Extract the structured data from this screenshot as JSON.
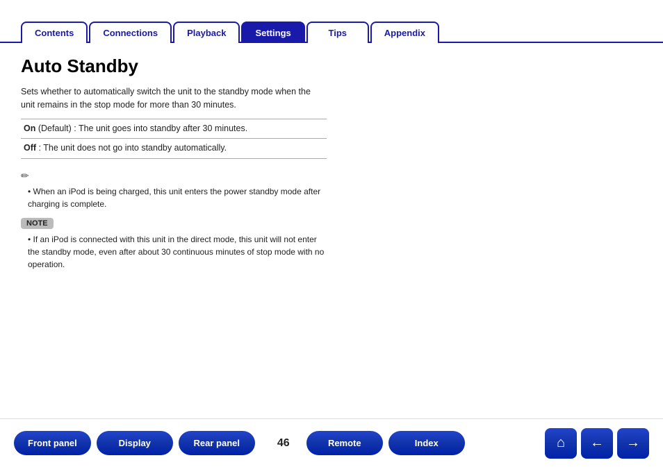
{
  "tabs": [
    {
      "id": "contents",
      "label": "Contents",
      "active": false
    },
    {
      "id": "connections",
      "label": "Connections",
      "active": false
    },
    {
      "id": "playback",
      "label": "Playback",
      "active": false
    },
    {
      "id": "settings",
      "label": "Settings",
      "active": true
    },
    {
      "id": "tips",
      "label": "Tips",
      "active": false
    },
    {
      "id": "appendix",
      "label": "Appendix",
      "active": false
    }
  ],
  "page": {
    "title": "Auto Standby",
    "description": "Sets whether to automatically switch the unit to the standby mode when the unit remains in the stop mode for more than 30 minutes.",
    "settings": [
      {
        "label": "On",
        "label_extra": " (Default) : The unit goes into standby after 30 minutes."
      },
      {
        "label": "Off",
        "label_extra": " : The unit does not go into standby automatically."
      }
    ],
    "tip_text": "When an iPod is being charged, this unit enters the power standby mode after charging is complete.",
    "note_label": "NOTE",
    "note_text": "If an iPod is connected with this unit in the direct mode, this unit will not enter the standby mode, even after about 30 continuous minutes of stop mode with no operation."
  },
  "bottom_nav": {
    "page_number": "46",
    "buttons": [
      {
        "id": "front-panel",
        "label": "Front panel"
      },
      {
        "id": "display",
        "label": "Display"
      },
      {
        "id": "rear-panel",
        "label": "Rear panel"
      },
      {
        "id": "remote",
        "label": "Remote"
      },
      {
        "id": "index",
        "label": "Index"
      }
    ],
    "icons": [
      {
        "id": "home",
        "symbol": "⌂"
      },
      {
        "id": "back",
        "symbol": "←"
      },
      {
        "id": "forward",
        "symbol": "→"
      }
    ]
  }
}
